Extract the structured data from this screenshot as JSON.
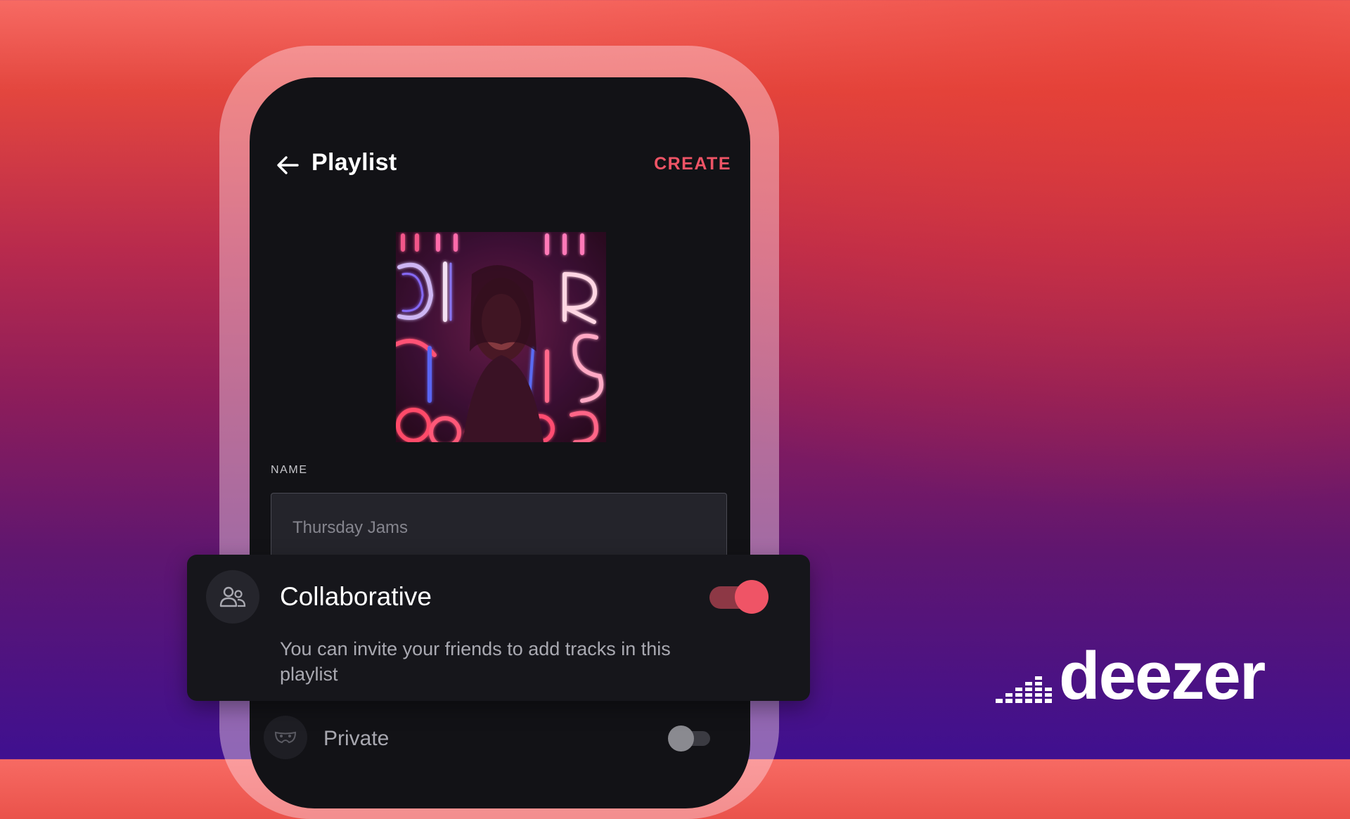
{
  "app": {
    "header": {
      "back_icon": "arrow-left-icon",
      "title": "Playlist",
      "create_label": "CREATE"
    },
    "cover": {
      "description_icon": "playlist-cover-image"
    },
    "name_field": {
      "label": "NAME",
      "placeholder": "Thursday Jams",
      "value": ""
    },
    "collaborative": {
      "icon": "users-icon",
      "title": "Collaborative",
      "description": "You can invite your friends to add tracks in this playlist",
      "enabled": true
    },
    "private": {
      "icon": "mask-icon",
      "title": "Private",
      "enabled": false
    }
  },
  "brand": {
    "logo_text": "deezer",
    "logo_icon": "equalizer-bars-icon"
  },
  "colors": {
    "accent": "#ef5466",
    "screen_bg": "#121216",
    "card_bg": "#16161b"
  }
}
